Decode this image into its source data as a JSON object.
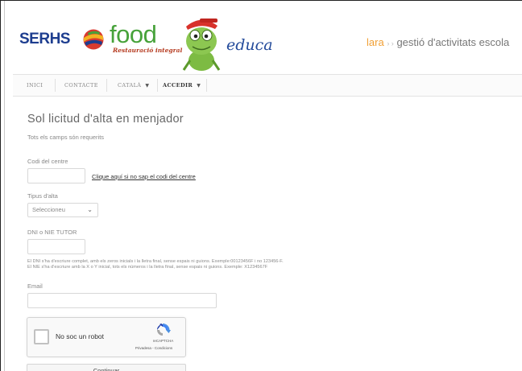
{
  "header": {
    "logo_serhs": "SERHS",
    "logo_food": "food",
    "logo_food_sub": "Restauració integral",
    "logo_educa": "educa",
    "tagline_brand": "lara",
    "tagline_sep": "› ›",
    "tagline_text": "gestió d'activitats escola"
  },
  "nav": {
    "items": [
      {
        "label": "INICI",
        "has_caret": false
      },
      {
        "label": "CONTACTE",
        "has_caret": false
      },
      {
        "label": "CATALÀ",
        "has_caret": true
      },
      {
        "label": "ACCEDIR",
        "has_caret": true
      }
    ],
    "caret_icon": "▼"
  },
  "form": {
    "title": "Sol licitud d'alta en menjador",
    "required_note": "Tots els camps són requerits",
    "centre_code_label": "Codi del centre",
    "centre_code_value": "",
    "centre_code_link": "Clique aquí si no sap el codi del centre",
    "alta_type_label": "Tipus d'alta",
    "alta_type_selected": "Seleccioneu",
    "dni_label": "DNI o NIE TUTOR",
    "dni_value": "",
    "help_line_1": "El DNI s'ha d'escriure complet, amb els zeros inicials i la lletra final, sense espais ni guions. Exemple:00123456F i no 123456-F.",
    "help_line_2": "El NIE s'ha d'escriure amb la X o Y inicial, tots els números i la lletra final, sense espais ni guions. Exemple: X1234567F",
    "email_label": "Email",
    "email_value": "",
    "submit_label": "Continuar"
  },
  "recaptcha": {
    "label": "No soc un robot",
    "brand": "reCAPTCHA",
    "links": "Privadesa - Condicions",
    "checked": false
  },
  "colors": {
    "serhs_blue": "#1d3d8f",
    "food_green": "#47a23a",
    "lara_orange": "#f1a035",
    "educa_blue": "#234a9a"
  }
}
